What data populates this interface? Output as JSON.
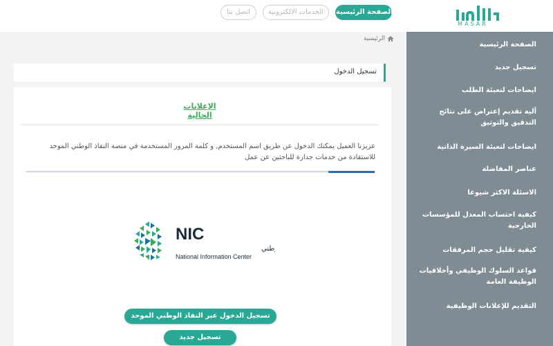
{
  "header": {
    "nav": {
      "home": "الصفحة الرئيسية",
      "services": "الخدمات الالكترونية",
      "contact": "اتصل بنا"
    },
    "logo_word": "MASAR",
    "brand_color": "#2aa896"
  },
  "sidebar": {
    "items": [
      "الصفحة الرئيسية",
      "تسجيل جديد",
      "ايضاحات لتعبئة الطلب",
      "آلية تقديم إعتراض على نتائج التدقيق والتوثيق",
      "ايضاحات لتعبئة السيرة الذاتية",
      "عناصر المفاضلة",
      "الاسئلة الاكثر شيوعا",
      "كيفية احتساب المعدل للمؤسسات الخارجية",
      "كيفية تقليل حجم المرفقات",
      "قواعد السلوك الوظيفي وأخلاقيات الوظيفة العامة",
      "التقديم للإعلانات الوظيفية"
    ],
    "background": "#808c94"
  },
  "main": {
    "breadcrumb": "الرئيسية",
    "panel_title": "تسجيل الدخول",
    "ads_title": "الإعلانات الحالية",
    "notice": "عزيزنا العميل يمكنك الدخول عن طريق اسم المستخدم, و كلمة المرور المستخدمة في منصة النفاذ الوطني الموحد للاستفادة من خدمات جدارة للباحثين عن عمل",
    "nic": {
      "abbr": "NIC",
      "name_ar": "مركز المعلومات الوطني",
      "name_en": "National Information Center"
    },
    "buttons": {
      "nafath_login": "تسجيل الدخول عبر النفاذ الوطني الموحد",
      "register": "تسجيل جديد"
    }
  }
}
